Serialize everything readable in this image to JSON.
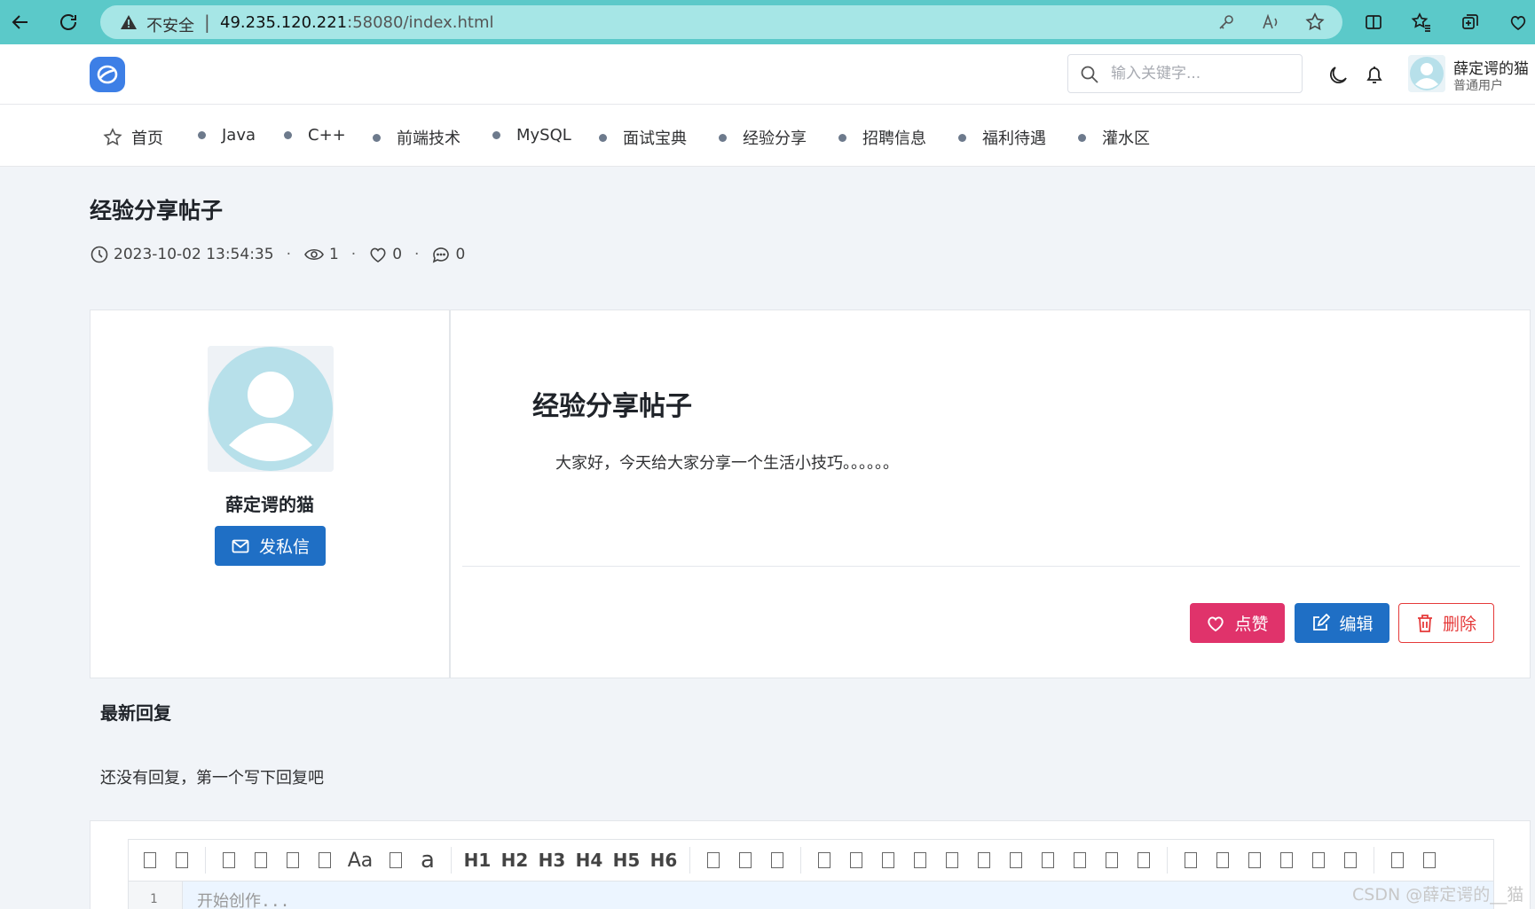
{
  "browser": {
    "insecure_label": "不安全",
    "separator": "|",
    "url_host": "49.235.120.221",
    "url_rest": ":58080/index.html",
    "colors": {
      "bar": "#5bc9c9",
      "address": "#a6e6e6"
    }
  },
  "header": {
    "search_placeholder": "输入关键字...",
    "user_name": "薛定谔的猫",
    "user_role": "普通用户"
  },
  "nav": {
    "items": [
      {
        "label": "首页",
        "icon": "star-icon"
      },
      {
        "label": "Java"
      },
      {
        "label": "C++"
      },
      {
        "label": "前端技术"
      },
      {
        "label": "MySQL"
      },
      {
        "label": "面试宝典"
      },
      {
        "label": "经验分享"
      },
      {
        "label": "招聘信息"
      },
      {
        "label": "福利待遇"
      },
      {
        "label": "灌水区"
      }
    ]
  },
  "post": {
    "title": "经验分享帖子",
    "datetime": "2023-10-02 13:54:35",
    "views": "1",
    "likes": "0",
    "comments": "0",
    "meta_separator": "·",
    "content_title": "经验分享帖子",
    "content_body": "大家好，今天给大家分享一个生活小技巧。。。。。。"
  },
  "author": {
    "name": "薛定谔的猫",
    "dm_label": "发私信"
  },
  "actions": {
    "like_label": "点赞",
    "edit_label": "编辑",
    "delete_label": "删除",
    "colors": {
      "like": "#e0336b",
      "edit": "#1f6fc5",
      "delete": "#e53a3a"
    }
  },
  "replies": {
    "title": "最新回复",
    "empty_text": "还没有回复，第一个写下回复吧"
  },
  "editor": {
    "toolbar_text_buttons": [
      "Aa",
      "a"
    ],
    "headings": [
      "H1",
      "H2",
      "H3",
      "H4",
      "H5",
      "H6"
    ],
    "line_number": "1",
    "placeholder": "开始创作..."
  },
  "watermark": "CSDN @薛定谔的__猫"
}
